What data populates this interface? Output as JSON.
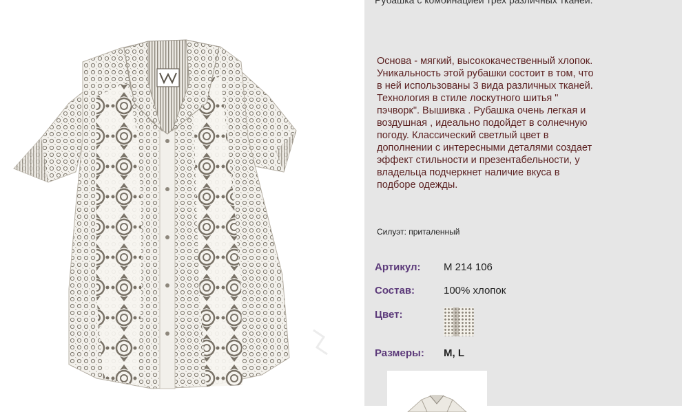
{
  "product": {
    "subtitle": "Рубашка с комбинацией трех различных тканей.",
    "description": "Основа - мягкий, высококачественный хлопок. Уникальность этой рубашки состоит в том, что в ней использованы 3 вида различных тканей. Технология в стиле лоскутного шитья  \" пэчворк\". Вышивка . Рубашка очень легкая и воздушная , идеально подойдет  в солнечную погоду. Классический светлый цвет  в дополнении с интересными деталями создает эффект стильности и презентабельности, у владельца подчеркнет наличие вкуса в подборе одежды.",
    "silhouette": "Силуэт: приталенный",
    "article_label": "Артикул:",
    "article_value": "M 214 106",
    "composition_label": "Состав:",
    "composition_value": "100% хлопок",
    "color_label": "Цвет:",
    "sizes_label": "Размеры:",
    "sizes_value": "M, L"
  },
  "colors": {
    "right_panel_bg": "#e6e6e6",
    "description_text": "#5a1f1f",
    "label_text": "#5c3a7a"
  },
  "icons": {
    "main_image": "shirt-photo",
    "color_swatch": "fabric-swatch",
    "thumbnail": "shirt-thumbnail"
  }
}
